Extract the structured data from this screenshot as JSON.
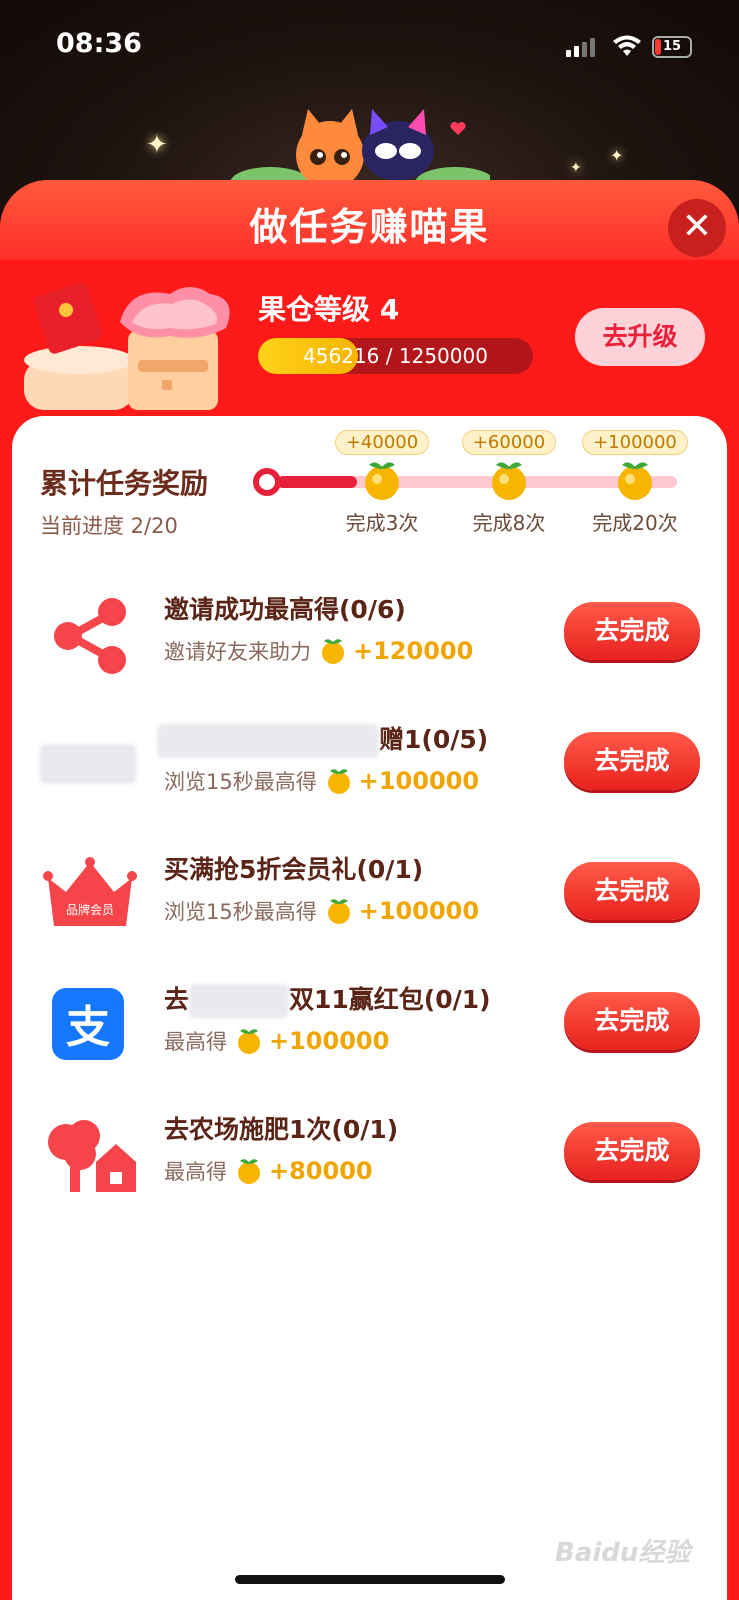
{
  "status_bar": {
    "time": "08:36",
    "battery": "15"
  },
  "modal": {
    "title": "做任务赚喵果",
    "close_icon": "close-icon",
    "level": {
      "title": "果仓等级 4",
      "progress_text": "456216 / 1250000",
      "progress_current": 456216,
      "progress_total": 1250000,
      "upgrade_label": "去升级"
    }
  },
  "cumulative": {
    "title": "累计任务奖励",
    "progress_label": "当前进度 2/20",
    "milestones": [
      {
        "reward": "+40000",
        "label": "完成3次"
      },
      {
        "reward": "+60000",
        "label": "完成8次"
      },
      {
        "reward": "+100000",
        "label": "完成20次"
      }
    ]
  },
  "tasks": [
    {
      "icon": "share-icon",
      "title": "邀请成功最高得(0/6)",
      "desc": "邀请好友来助力",
      "amount": "+120000",
      "button": "去完成"
    },
    {
      "icon": "blurred-brand-icon",
      "title_suffix": "赠1(0/5)",
      "desc": "浏览15秒最高得",
      "amount": "+100000",
      "button": "去完成"
    },
    {
      "icon": "brand-member-crown-icon",
      "crown_text": "品牌会员",
      "title": "买满抢5折会员礼(0/1)",
      "desc": "浏览15秒最高得",
      "amount": "+100000",
      "button": "去完成"
    },
    {
      "icon": "alipay-icon",
      "alipay_glyph": "支",
      "title_prefix": "去",
      "title_suffix": "双11赢红包(0/1)",
      "desc": "最高得",
      "amount": "+100000",
      "button": "去完成"
    },
    {
      "icon": "farm-tree-house-icon",
      "title": "去农场施肥1次(0/1)",
      "desc": "最高得",
      "amount": "+80000",
      "button": "去完成"
    }
  ],
  "watermark": "Baidu经验",
  "colors": {
    "primary_red": "#ff1a1a",
    "button_red": "#e8221e",
    "gold": "#f0a500",
    "title_brown": "#5a2416"
  }
}
